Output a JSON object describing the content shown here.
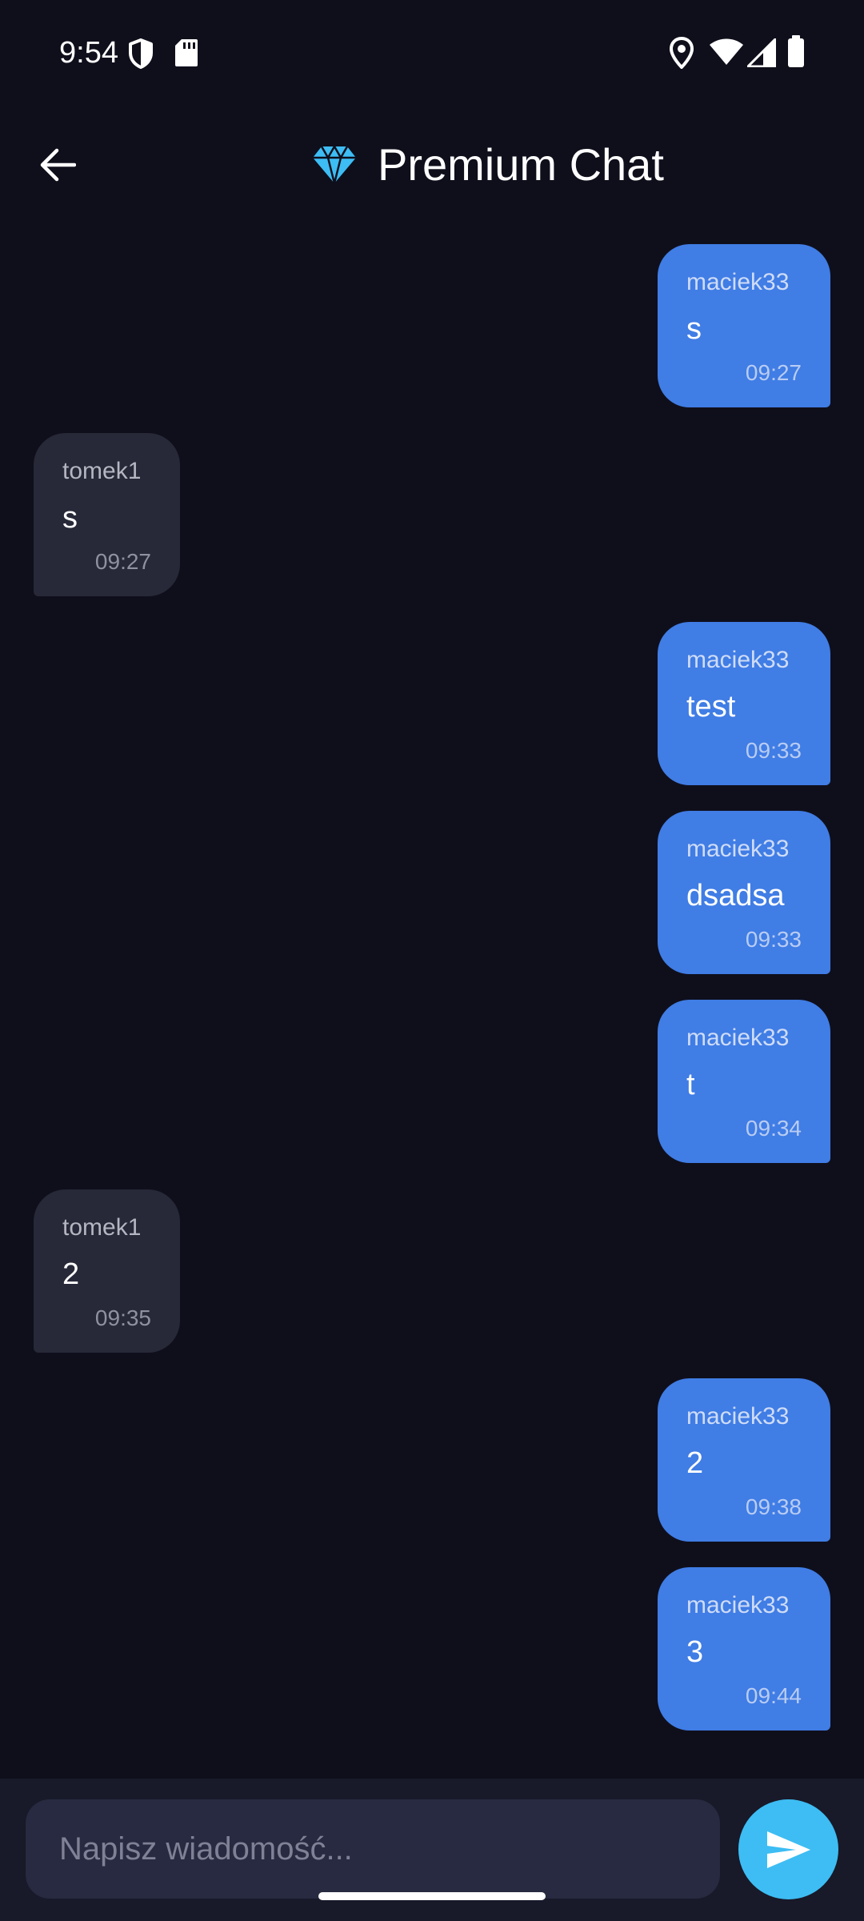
{
  "status_bar": {
    "time": "9:54",
    "icons": [
      "shield-icon",
      "sd-card-icon",
      "location-icon",
      "wifi-icon",
      "signal-icon",
      "battery-icon"
    ]
  },
  "app_bar": {
    "back_icon": "arrow-back-icon",
    "title_icon": "diamond-icon",
    "title": "Premium Chat"
  },
  "messages": [
    {
      "direction": "outgoing",
      "sender": "maciek33",
      "text": "s",
      "time": "09:27"
    },
    {
      "direction": "incoming",
      "sender": "tomek1",
      "text": "s",
      "time": "09:27"
    },
    {
      "direction": "outgoing",
      "sender": "maciek33",
      "text": "test",
      "time": "09:33"
    },
    {
      "direction": "outgoing",
      "sender": "maciek33",
      "text": "dsadsa",
      "time": "09:33"
    },
    {
      "direction": "outgoing",
      "sender": "maciek33",
      "text": "t",
      "time": "09:34"
    },
    {
      "direction": "incoming",
      "sender": "tomek1",
      "text": "2",
      "time": "09:35"
    },
    {
      "direction": "outgoing",
      "sender": "maciek33",
      "text": "2",
      "time": "09:38"
    },
    {
      "direction": "outgoing",
      "sender": "maciek33",
      "text": "3",
      "time": "09:44"
    }
  ],
  "composer": {
    "placeholder": "Napisz wiadomość...",
    "value": "",
    "send_icon": "send-icon"
  },
  "colors": {
    "background": "#0f0f1c",
    "outgoing_bubble": "#407de5",
    "incoming_bubble": "#272838",
    "accent": "#3dbdf3"
  }
}
